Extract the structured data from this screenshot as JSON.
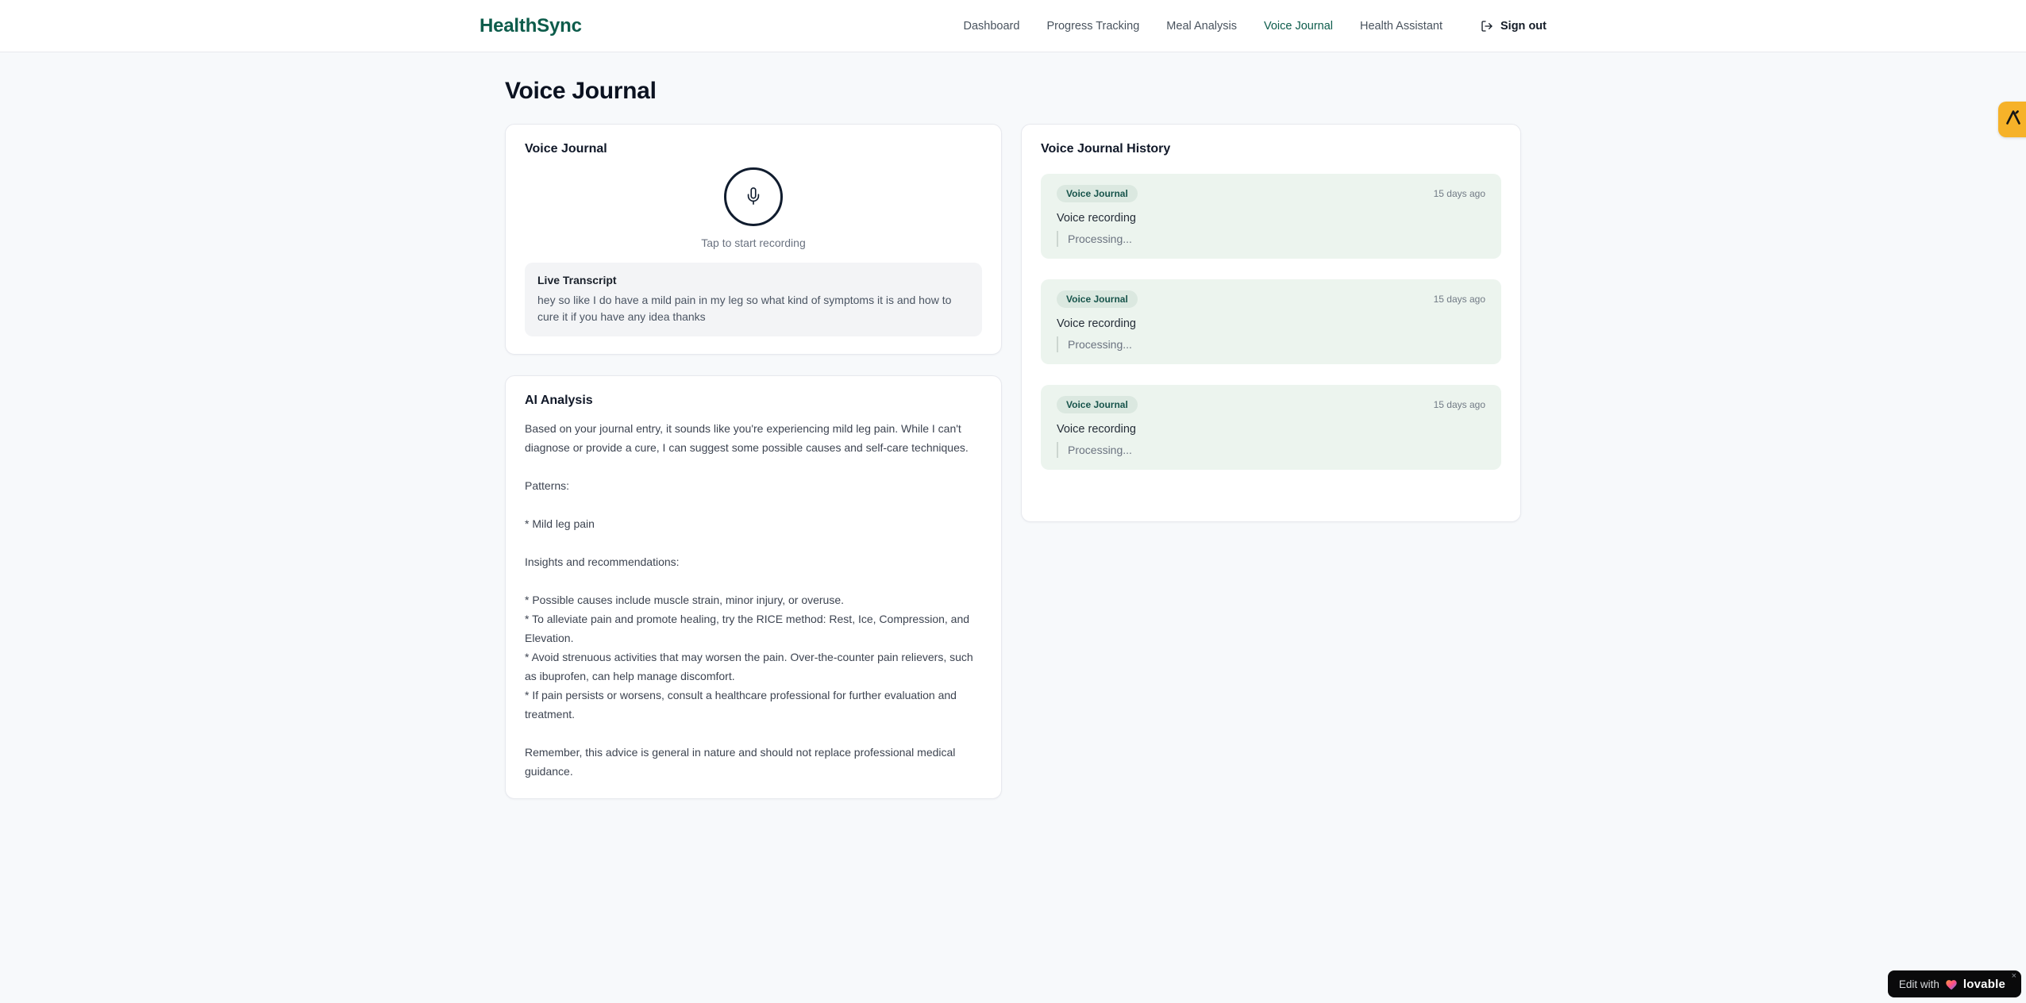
{
  "brand": "HealthSync",
  "nav": {
    "items": [
      {
        "label": "Dashboard",
        "name": "dashboard",
        "active": false
      },
      {
        "label": "Progress Tracking",
        "name": "progress-tracking",
        "active": false
      },
      {
        "label": "Meal Analysis",
        "name": "meal-analysis",
        "active": false
      },
      {
        "label": "Voice Journal",
        "name": "voice-journal",
        "active": true
      },
      {
        "label": "Health Assistant",
        "name": "health-assistant",
        "active": false
      }
    ],
    "sign_out_label": "Sign out"
  },
  "page": {
    "title": "Voice Journal"
  },
  "recorder": {
    "card_title": "Voice Journal",
    "mic_icon": "microphone-icon",
    "tap_label": "Tap to start recording",
    "transcript_title": "Live Transcript",
    "transcript_text": "hey so like I do have a mild pain in my leg so what kind of symptoms it is and how to cure it if you have any idea thanks"
  },
  "analysis": {
    "card_title": "AI Analysis",
    "body": "Based on your journal entry, it sounds like you're experiencing mild leg pain. While I can't diagnose or provide a cure, I can suggest some possible causes and self-care techniques.\n\nPatterns:\n\n* Mild leg pain\n\nInsights and recommendations:\n\n* Possible causes include muscle strain, minor injury, or overuse.\n* To alleviate pain and promote healing, try the RICE method: Rest, Ice, Compression, and Elevation.\n* Avoid strenuous activities that may worsen the pain. Over-the-counter pain relievers, such as ibuprofen, can help manage discomfort.\n* If pain persists or worsens, consult a healthcare professional for further evaluation and treatment.\n\nRemember, this advice is general in nature and should not replace professional medical guidance."
  },
  "history": {
    "card_title": "Voice Journal History",
    "items": [
      {
        "badge": "Voice Journal",
        "time": "15 days ago",
        "title": "Voice recording",
        "status": "Processing..."
      },
      {
        "badge": "Voice Journal",
        "time": "15 days ago",
        "title": "Voice recording",
        "status": "Processing..."
      },
      {
        "badge": "Voice Journal",
        "time": "15 days ago",
        "title": "Voice recording",
        "status": "Processing..."
      }
    ]
  },
  "floating": {
    "edge_badge_icon": "lambda-logo-icon",
    "lovable": {
      "prefix": "Edit with",
      "brand": "lovable",
      "close": "×",
      "heart_icon": "gradient-heart-icon"
    }
  },
  "colors": {
    "accent_teal": "#0d5c4b",
    "history_item_bg": "#ecf4ee",
    "badge_bg": "#dbe8e0",
    "badge_text": "#17544b",
    "edge_badge_bg": "#f6b229",
    "lovable_bg": "#0a0a0b",
    "page_bg": "#f7f9fb"
  }
}
